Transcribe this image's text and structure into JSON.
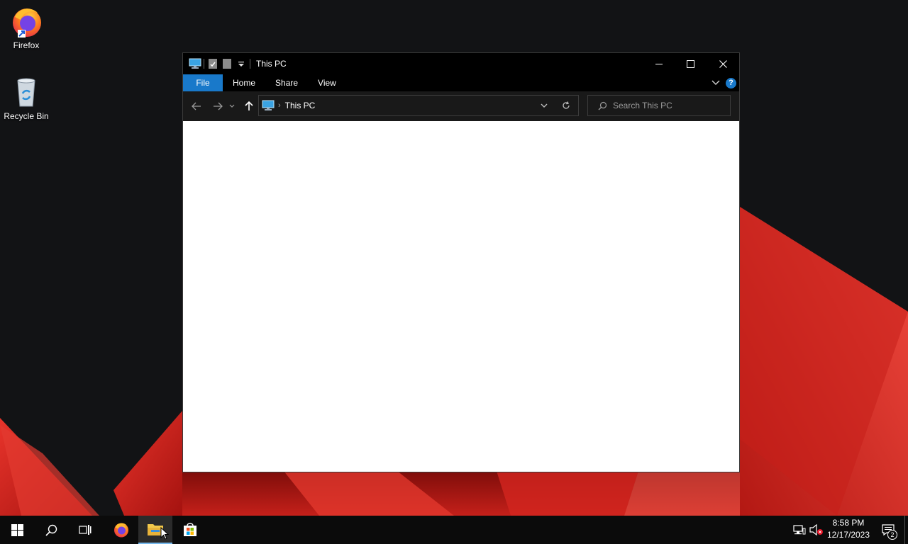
{
  "desktop": {
    "icons": [
      {
        "label": "Firefox"
      },
      {
        "label": "Recycle Bin"
      }
    ]
  },
  "explorer": {
    "title": "This PC",
    "ribbon_tabs": [
      "File",
      "Home",
      "Share",
      "View"
    ],
    "address": {
      "crumb": "This PC"
    },
    "search": {
      "placeholder": "Search This PC"
    }
  },
  "taskbar": {
    "pinned": [
      "start",
      "search",
      "task-view",
      "firefox",
      "file-explorer",
      "microsoft-store"
    ],
    "active": "file-explorer"
  },
  "tray": {
    "time": "8:58 PM",
    "date": "12/17/2023",
    "notification_count": "2"
  },
  "colors": {
    "accent": "#1979ca",
    "taskbar_active": "#76b9ed",
    "wallpaper_red": "#d8261f"
  }
}
